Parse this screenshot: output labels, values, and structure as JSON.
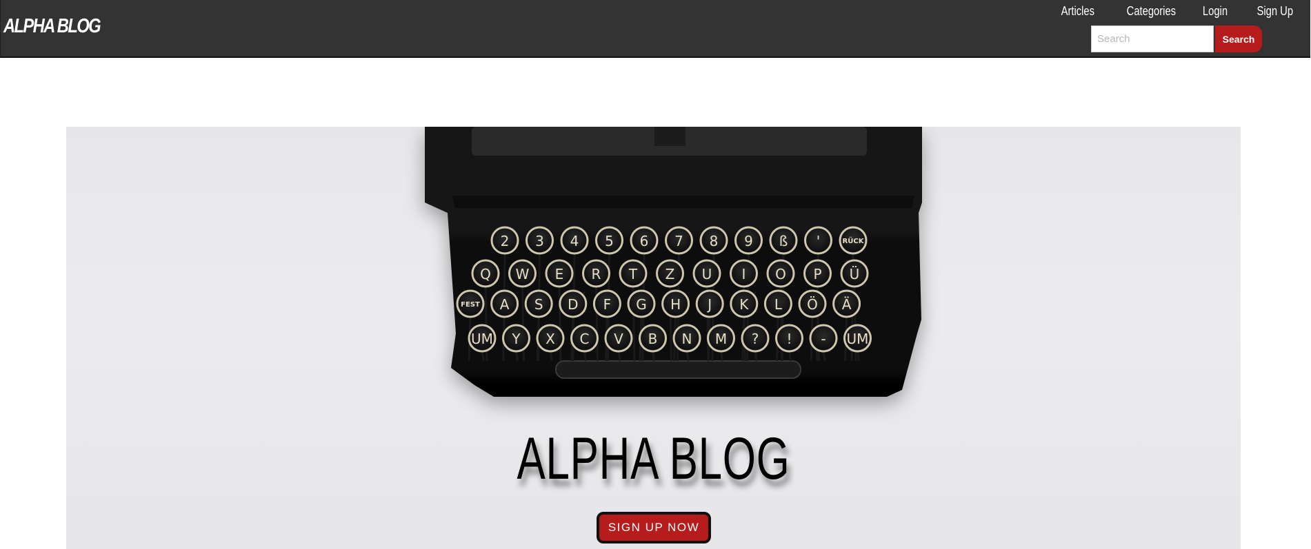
{
  "navbar": {
    "brand": "ALPHA BLOG",
    "links": [
      "Articles",
      "Categories",
      "Login",
      "Sign Up"
    ],
    "search": {
      "placeholder": "Search",
      "value": "",
      "button_label": "Search"
    }
  },
  "hero": {
    "title": "ALPHA BLOG",
    "cta_label": "SIGN UP NOW",
    "image_icon": "typewriter-image",
    "keys_row1": [
      "2",
      "3",
      "4",
      "5",
      "6",
      "7",
      "8",
      "9",
      "ß",
      "'",
      "RÜCK"
    ],
    "keys_row2": [
      "Q",
      "W",
      "E",
      "R",
      "T",
      "Z",
      "U",
      "I",
      "O",
      "P",
      "Ü"
    ],
    "keys_row3": [
      "FEST",
      "A",
      "S",
      "D",
      "F",
      "G",
      "H",
      "J",
      "K",
      "L",
      "Ö",
      "Ä"
    ],
    "keys_row4": [
      "UM",
      "Y",
      "X",
      "C",
      "V",
      "B",
      "N",
      "M",
      "?",
      "!",
      "-",
      "UM"
    ]
  },
  "colors": {
    "navbar": "#333333",
    "accent": "#b71c1c",
    "hero_bg": "#e9e9ec"
  }
}
